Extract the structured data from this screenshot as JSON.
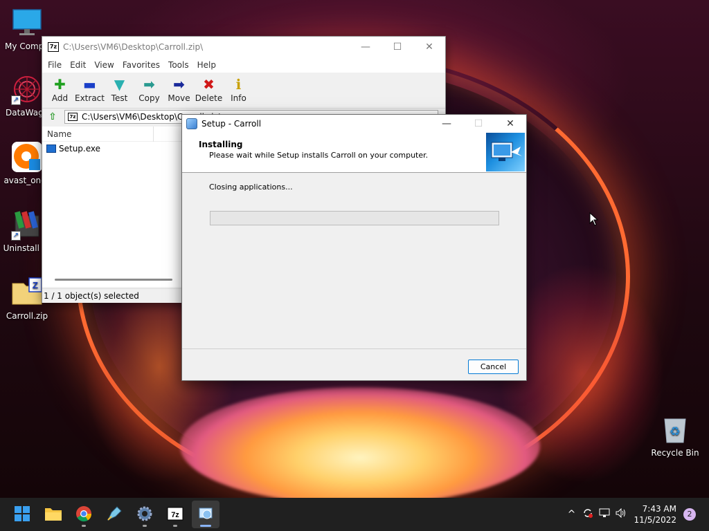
{
  "desktop": {
    "icons": [
      {
        "label": "My Compu",
        "icon": "monitor-icon"
      },
      {
        "label": "DataWago",
        "icon": "datawagon-icon"
      },
      {
        "label": "avast_one_",
        "icon": "avast-icon"
      },
      {
        "label": "Uninstall To",
        "icon": "uninstall-tool-icon"
      },
      {
        "label": "Carroll.zip",
        "icon": "zip-archive-icon"
      },
      {
        "label": "Recycle Bin",
        "icon": "recycle-bin-icon"
      }
    ]
  },
  "zip_window": {
    "title": "C:\\Users\\VM6\\Desktop\\Carroll.zip\\",
    "logo": "7z",
    "controls": {
      "minimize": "—",
      "maximize": "☐",
      "close": "✕"
    },
    "menu": [
      "File",
      "Edit",
      "View",
      "Favorites",
      "Tools",
      "Help"
    ],
    "toolbar": [
      {
        "label": "Add",
        "glyph": "✚",
        "color": "#1fa01f"
      },
      {
        "label": "Extract",
        "glyph": "▬",
        "color": "#1a3fc8"
      },
      {
        "label": "Test",
        "glyph": "▼",
        "color": "#2ab0b0"
      },
      {
        "label": "Copy",
        "glyph": "➡",
        "color": "#2a9a90"
      },
      {
        "label": "Move",
        "glyph": "➡",
        "color": "#1a2a9a"
      },
      {
        "label": "Delete",
        "glyph": "✖",
        "color": "#d01818"
      },
      {
        "label": "Info",
        "glyph": "ℹ",
        "color": "#c8a000"
      }
    ],
    "address": "C:\\Users\\VM6\\Desktop\\Carroll.zip\\",
    "list_header": "Name",
    "files": [
      {
        "name": "Setup.exe"
      }
    ],
    "status": "1 / 1 object(s) selected"
  },
  "setup_window": {
    "title": "Setup - Carroll",
    "controls": {
      "minimize": "—",
      "maximize": "☐",
      "close": "✕"
    },
    "heading": "Installing",
    "subheading": "Please wait while Setup installs Carroll on your computer.",
    "status": "Closing applications...",
    "progress": 0,
    "cancel_label": "Cancel"
  },
  "taskbar": {
    "apps": [
      "windows-start-icon",
      "file-explorer-icon",
      "chrome-icon",
      "pen-tool-icon",
      "settings-gear-icon",
      "7zip-icon",
      "setup-installer-icon"
    ],
    "tray": {
      "chevron": "^",
      "clock_time": "7:43 AM",
      "clock_date": "11/5/2022",
      "notifications": "2"
    }
  }
}
